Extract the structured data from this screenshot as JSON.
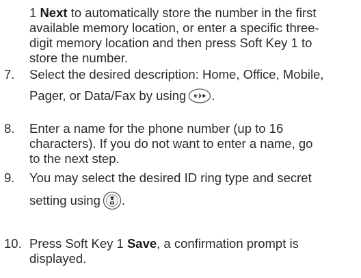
{
  "continuation": {
    "prefix": "1 ",
    "bold": "Next",
    "line1_rest": " to automatically store the number in the first",
    "line2": "available memory location, or enter a specific three-",
    "line3": "digit memory location and then press Soft Key 1 to",
    "line4": "store the number."
  },
  "steps": [
    {
      "number": "7.",
      "line1": "Select the desired description: Home, Office, Mobile,",
      "line2_pre": "Pager, or Data/Fax by using",
      "line2_post": ".",
      "icon": "navigation-key-icon"
    },
    {
      "number": "8.",
      "line1": "Enter a name for the phone number (up to 16",
      "line2": "characters). If you do not want to enter a name, go",
      "line3": "to the next step."
    },
    {
      "number": "9.",
      "line1": "You may select the desired ID ring type and secret",
      "line2_pre": "setting using",
      "line2_post": ".",
      "icon": "side-volume-key-icon"
    },
    {
      "number": "10.",
      "line1_pre": "Press Soft Key 1 ",
      "line1_bold": "Save",
      "line1_post": ", a confirmation prompt is",
      "line2": "displayed."
    }
  ]
}
